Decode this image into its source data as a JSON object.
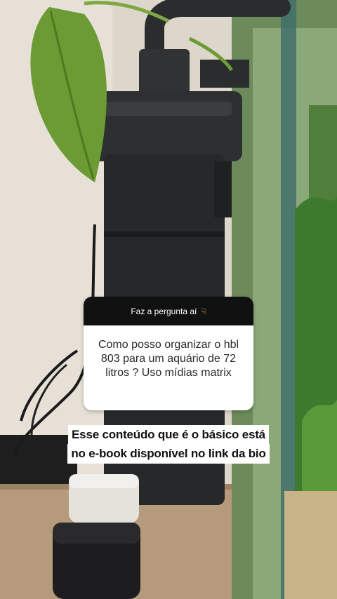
{
  "question_box": {
    "header": "Faz a pergunta aí",
    "header_icon": "pointing-down-hand-icon",
    "question": "Como posso organizar o hbl 803 para um aquário de 72 litros ? Uso mídias matrix"
  },
  "caption": {
    "line1": "Esse conteúdo que é o básico está",
    "line2": "no e-book disponível no link da bio"
  },
  "colors": {
    "header_bg": "#111111",
    "caption_bg": "#ffffff",
    "filter_body": "#2b2d2f",
    "plant_green": "#5f8f2e"
  }
}
